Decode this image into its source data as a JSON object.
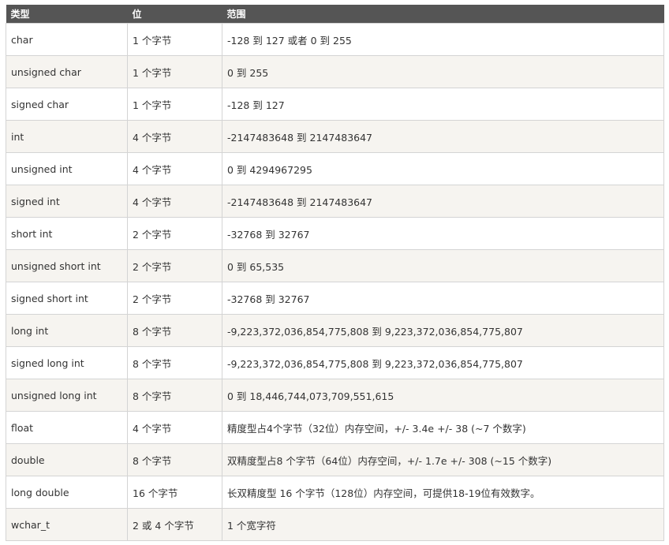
{
  "table": {
    "headers": [
      "类型",
      "位",
      "范围"
    ],
    "rows": [
      [
        "char",
        "1 个字节",
        "-128 到 127 或者 0 到 255"
      ],
      [
        "unsigned char",
        "1 个字节",
        "0 到 255"
      ],
      [
        "signed char",
        "1 个字节",
        "-128 到 127"
      ],
      [
        "int",
        "4 个字节",
        "-2147483648 到 2147483647"
      ],
      [
        "unsigned int",
        "4 个字节",
        "0 到 4294967295"
      ],
      [
        "signed int",
        "4 个字节",
        "-2147483648 到 2147483647"
      ],
      [
        "short int",
        "2 个字节",
        "-32768 到 32767"
      ],
      [
        "unsigned short int",
        "2 个字节",
        "0 到 65,535"
      ],
      [
        "signed short int",
        "2 个字节",
        "-32768 到 32767"
      ],
      [
        "long int",
        "8 个字节",
        "-9,223,372,036,854,775,808 到 9,223,372,036,854,775,807"
      ],
      [
        "signed long int",
        "8 个字节",
        "-9,223,372,036,854,775,808 到 9,223,372,036,854,775,807"
      ],
      [
        "unsigned long int",
        "8 个字节",
        "0 到 18,446,744,073,709,551,615"
      ],
      [
        "float",
        "4 个字节",
        "精度型占4个字节（32位）内存空间，+/- 3.4e +/- 38 (~7 个数字)"
      ],
      [
        "double",
        "8 个字节",
        "双精度型占8 个字节（64位）内存空间，+/- 1.7e +/- 308 (~15 个数字)"
      ],
      [
        "long double",
        "16 个字节",
        "长双精度型 16 个字节（128位）内存空间，可提供18-19位有效数字。"
      ],
      [
        "wchar_t",
        "2 或 4 个字节",
        "1 个宽字符"
      ]
    ]
  }
}
